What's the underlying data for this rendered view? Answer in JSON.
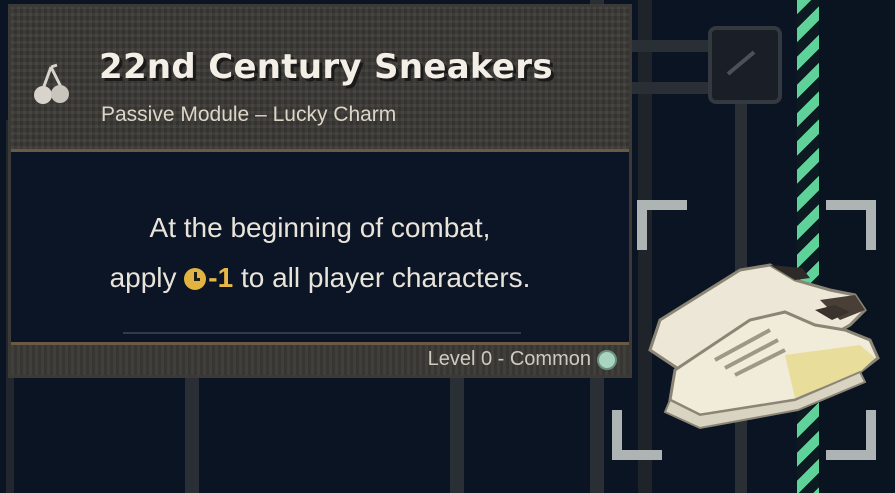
{
  "item": {
    "title": "22nd Century Sneakers",
    "subtitle": "Passive Module – Lucky Charm",
    "icon": "cherry-icon",
    "description_line1": "At the beginning of combat,",
    "description_prefix": "apply",
    "time_effect_icon": "clock-icon",
    "time_effect_value": "-1",
    "description_suffix": "to all player characters.",
    "rarity_label": "Level 0 - Common",
    "rarity_color": "#a9d4c0"
  },
  "colors": {
    "accent_gold": "#e7b845",
    "hazard_green": "#5fd29a",
    "background": "#0b1422"
  }
}
